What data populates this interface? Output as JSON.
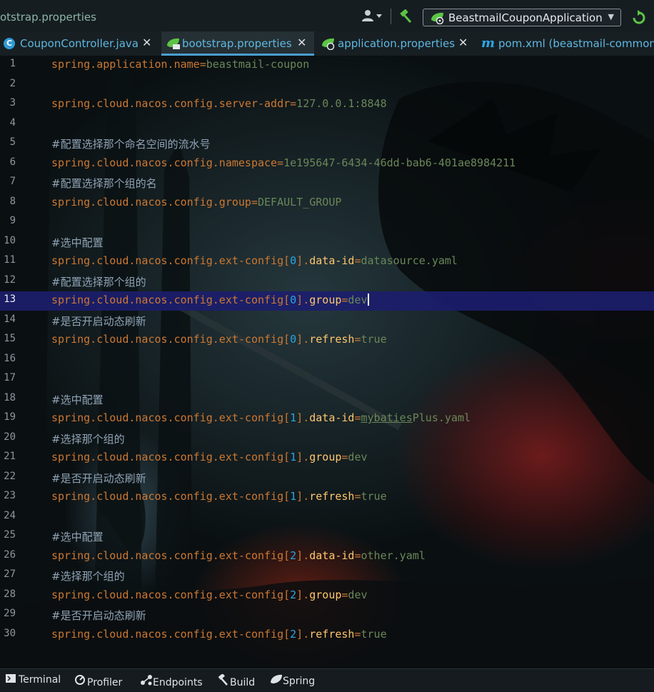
{
  "toolbar": {
    "breadcrumb": "otstrap.properties",
    "run_config": "BeastmailCouponApplication",
    "icons": [
      "user-menu-icon",
      "build-hammer-icon",
      "spring-boot-icon",
      "rerun-icon"
    ]
  },
  "tabs": [
    {
      "label": "CouponController.java",
      "icon": "class-c-icon",
      "active": false
    },
    {
      "label": "bootstrap.properties",
      "icon": "properties-icon",
      "active": true
    },
    {
      "label": "application.properties",
      "icon": "spring-properties-icon",
      "active": false
    },
    {
      "label": "pom.xml (beastmail-common)",
      "icon": "maven-m-icon",
      "active": false
    }
  ],
  "editor": {
    "current_line": 13,
    "lines": [
      {
        "n": "1",
        "text": "spring.application.name=beastmail-coupon"
      },
      {
        "n": "2",
        "text": ""
      },
      {
        "n": "3",
        "text": "spring.cloud.nacos.config.server-addr=127.0.0.1:8848"
      },
      {
        "n": "4",
        "text": ""
      },
      {
        "n": "5",
        "text": "#配置选择那个命名空间的流水号"
      },
      {
        "n": "6",
        "text": "spring.cloud.nacos.config.namespace=1e195647-6434-46dd-bab6-401ae8984211"
      },
      {
        "n": "7",
        "text": "#配置选择那个组的名"
      },
      {
        "n": "8",
        "text": "spring.cloud.nacos.config.group=DEFAULT_GROUP"
      },
      {
        "n": "9",
        "text": ""
      },
      {
        "n": "10",
        "text": "#选中配置"
      },
      {
        "n": "11",
        "text": "spring.cloud.nacos.config.ext-config[0].data-id=datasource.yaml"
      },
      {
        "n": "12",
        "text": "#配置选择那个组的"
      },
      {
        "n": "13",
        "text": "spring.cloud.nacos.config.ext-config[0].group=dev"
      },
      {
        "n": "14",
        "text": "#是否开启动态刷新"
      },
      {
        "n": "15",
        "text": "spring.cloud.nacos.config.ext-config[0].refresh=true"
      },
      {
        "n": "16",
        "text": ""
      },
      {
        "n": "17",
        "text": ""
      },
      {
        "n": "18",
        "text": "#选中配置"
      },
      {
        "n": "19",
        "text": "spring.cloud.nacos.config.ext-config[1].data-id=mybatiesPlus.yaml"
      },
      {
        "n": "20",
        "text": "#选择那个组的"
      },
      {
        "n": "21",
        "text": "spring.cloud.nacos.config.ext-config[1].group=dev"
      },
      {
        "n": "22",
        "text": "#是否开启动态刷新"
      },
      {
        "n": "23",
        "text": "spring.cloud.nacos.config.ext-config[1].refresh=true"
      },
      {
        "n": "24",
        "text": ""
      },
      {
        "n": "25",
        "text": "#选中配置"
      },
      {
        "n": "26",
        "text": "spring.cloud.nacos.config.ext-config[2].data-id=other.yaml"
      },
      {
        "n": "27",
        "text": "#选择那个组的"
      },
      {
        "n": "28",
        "text": "spring.cloud.nacos.config.ext-config[2].group=dev"
      },
      {
        "n": "29",
        "text": "#是否开启动态刷新"
      },
      {
        "n": "30",
        "text": "spring.cloud.nacos.config.ext-config[2].refresh=true"
      }
    ]
  },
  "statusbar": {
    "items": [
      {
        "label": "Terminal",
        "icon": "terminal-icon"
      },
      {
        "label": "Profiler",
        "icon": "profiler-icon"
      },
      {
        "label": "Endpoints",
        "icon": "endpoints-icon"
      },
      {
        "label": "Build",
        "icon": "build-hammer-icon"
      },
      {
        "label": "Spring",
        "icon": "spring-leaf-icon"
      }
    ]
  },
  "colors": {
    "key": "#cc7832",
    "value": "#6a8759",
    "index": "#2aa5e0",
    "subkey": "#ffc66d",
    "comment": "#8fa3b5",
    "current_line": "#1c1e6e",
    "tab_text": "#5fb8e0"
  }
}
